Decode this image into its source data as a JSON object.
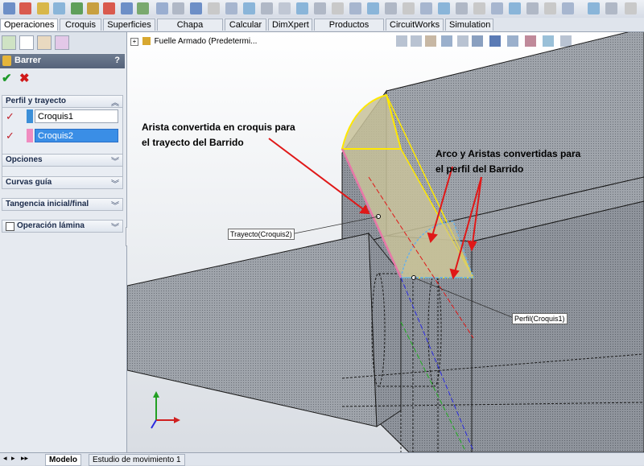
{
  "command_manager_tabs": [
    {
      "label": "Operaciones",
      "active": true
    },
    {
      "label": "Croquis"
    },
    {
      "label": "Superficies"
    },
    {
      "label": "Chapa metálica"
    },
    {
      "label": "Calcular"
    },
    {
      "label": "DimXpert"
    },
    {
      "label": "Productos Office"
    },
    {
      "label": "CircuitWorks"
    },
    {
      "label": "Simulation"
    }
  ],
  "property_manager": {
    "title": "Barrer",
    "help": "?",
    "ok_icon": "check-icon",
    "cancel_icon": "x-icon",
    "groups": {
      "perfil_trayecto": "Perfil y trayecto",
      "opciones": "Opciones",
      "curvas_guia": "Curvas guía",
      "tangencia": "Tangencia inicial/final",
      "operacion_lamina": "Operación lámina"
    },
    "profile_field": "Croquis1",
    "path_field": "Croquis2",
    "colors": {
      "profile_chip": "#3c8fd8",
      "path_chip": "#f08cc0",
      "selected_bg": "#3a8ee6"
    }
  },
  "feature_tree": {
    "root": "Fuelle Armado  (Predetermi..."
  },
  "viewport": {
    "callout_path_line1": "Arista convertida en croquis para",
    "callout_path_line2": "el trayecto del Barrido",
    "callout_profile_line1": "Arco y Aristas convertidas para",
    "callout_profile_line2": "el perfil del Barrido",
    "label_path": "Trayecto(Croquis2)",
    "label_profile": "Perfil(Croquis1)",
    "axis_icon": "triad-icon",
    "colors": {
      "profile": "#ffe800",
      "sweep_fill": "#c8c29a",
      "path": "#e878a8",
      "arrow": "#e01818",
      "edge": "#202020"
    }
  },
  "bottom_tabs": [
    {
      "label": "Modelo",
      "active": true
    },
    {
      "label": "Estudio de movimiento 1"
    }
  ]
}
